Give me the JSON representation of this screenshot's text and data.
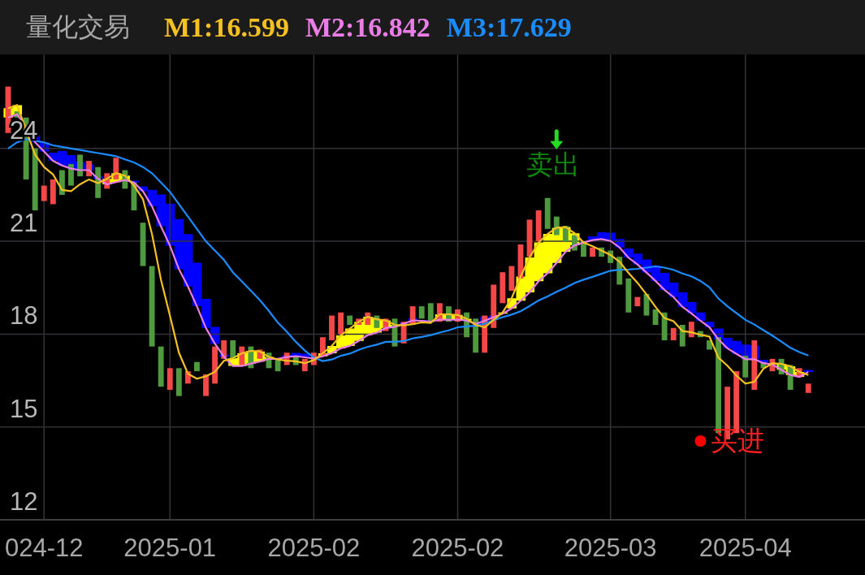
{
  "header": {
    "title": "量化交易",
    "readouts": [
      ":16.599",
      ":16.842",
      ":17.629"
    ]
  },
  "chart_data": {
    "type": "candlestick",
    "ylim": [
      12,
      27.04
    ],
    "grid": true,
    "categories": [
      null,
      null,
      null,
      null,
      "024-12",
      null,
      null,
      null,
      null,
      null,
      null,
      null,
      null,
      null,
      null,
      null,
      null,
      null,
      "2025-01",
      null,
      null,
      null,
      null,
      null,
      null,
      null,
      null,
      null,
      null,
      null,
      null,
      null,
      null,
      null,
      "2025-02",
      null,
      null,
      null,
      null,
      null,
      null,
      null,
      null,
      null,
      null,
      null,
      null,
      null,
      null,
      null,
      "2025-02",
      null,
      null,
      null,
      null,
      null,
      null,
      null,
      null,
      null,
      null,
      null,
      null,
      null,
      null,
      null,
      null,
      "2025-03",
      null,
      null,
      null,
      null,
      null,
      null,
      null,
      null,
      null,
      null,
      null,
      null,
      null,
      null,
      "2025-04",
      null,
      null,
      null,
      null,
      null,
      null,
      null
    ],
    "yticks": [
      12,
      15,
      18,
      21,
      24
    ],
    "ohlc": [
      [
        24.5,
        26,
        24.5,
        26
      ],
      [
        25.2,
        25.2,
        25,
        25
      ],
      [
        25,
        25,
        23,
        23
      ],
      [
        24,
        24,
        22,
        22
      ],
      [
        22.3,
        22.8,
        22.3,
        22.8
      ],
      [
        22.2,
        23,
        22.2,
        23
      ],
      [
        23.3,
        23.3,
        22.5,
        22.5
      ],
      [
        23.5,
        23.5,
        22.8,
        22.8
      ],
      [
        23.8,
        23.8,
        23.1,
        23.1
      ],
      [
        23.1,
        23.6,
        23.1,
        23.6
      ],
      [
        23.4,
        23.4,
        22.4,
        22.4
      ],
      [
        22.7,
        23.2,
        22.7,
        23.2
      ],
      [
        23,
        23.7,
        23,
        23.7
      ],
      [
        23.3,
        23.3,
        22.7,
        22.7
      ],
      [
        22.9,
        22.9,
        22,
        22
      ],
      [
        21.6,
        21.6,
        20.2,
        20.2
      ],
      [
        20.2,
        20.2,
        17.6,
        17.6
      ],
      [
        17.6,
        17.6,
        16.3,
        16.3
      ],
      [
        16.2,
        16.9,
        16.2,
        16.9
      ],
      [
        16.9,
        16.9,
        16,
        16
      ],
      [
        16.4,
        16.8,
        16.4,
        16.8
      ],
      [
        17.1,
        17.1,
        16.8,
        16.8
      ],
      [
        16,
        16.7,
        16,
        16.7
      ],
      [
        16.4,
        17.6,
        16.4,
        17.6
      ],
      [
        17.2,
        17.8,
        17.2,
        17.8
      ],
      [
        17.8,
        17.8,
        17.2,
        17.2
      ],
      [
        17,
        17.6,
        17,
        17.6
      ],
      [
        17.6,
        17.6,
        16.9,
        16.9
      ],
      [
        17.2,
        17.5,
        17.2,
        17.5
      ],
      [
        17.4,
        17.4,
        16.9,
        16.9
      ],
      [
        17.2,
        17.2,
        16.8,
        16.8
      ],
      [
        17,
        17.4,
        17,
        17.4
      ],
      [
        17.3,
        17.3,
        17,
        17
      ],
      [
        16.8,
        17.2,
        16.8,
        17.2
      ],
      [
        17,
        17.4,
        17,
        17.4
      ],
      [
        17.3,
        17.9,
        17.3,
        17.9
      ],
      [
        17.8,
        18.6,
        17.8,
        18.6
      ],
      [
        18,
        18.7,
        18,
        18.7
      ],
      [
        18.6,
        18.6,
        18.3,
        18.3
      ],
      [
        18.3,
        18.5,
        18.3,
        18.5
      ],
      [
        18.3,
        18.7,
        18.3,
        18.7
      ],
      [
        18.6,
        18.6,
        18.2,
        18.2
      ],
      [
        18.1,
        18.5,
        18.1,
        18.5
      ],
      [
        18.5,
        18.5,
        17.6,
        17.6
      ],
      [
        17.7,
        18.4,
        17.7,
        18.4
      ],
      [
        18.3,
        18.9,
        18.3,
        18.9
      ],
      [
        18.9,
        18.9,
        18.5,
        18.5
      ],
      [
        19,
        19,
        18.4,
        18.4
      ],
      [
        18.4,
        19,
        18.4,
        19
      ],
      [
        18.9,
        18.9,
        18.4,
        18.4
      ],
      [
        18.4,
        18.8,
        18.4,
        18.8
      ],
      [
        18.7,
        18.7,
        17.9,
        17.9
      ],
      [
        18.5,
        18.5,
        17.4,
        17.4
      ],
      [
        17.4,
        18.6,
        17.4,
        18.6
      ],
      [
        18.2,
        19.6,
        18.2,
        19.6
      ],
      [
        19,
        20,
        19,
        20
      ],
      [
        19.4,
        20.2,
        19.4,
        20.2
      ],
      [
        19.8,
        20.9,
        19.8,
        20.9
      ],
      [
        20.5,
        21.7,
        20.5,
        21.7
      ],
      [
        21,
        22,
        21,
        22
      ],
      [
        22.4,
        22.4,
        21.4,
        21.4
      ],
      [
        21.8,
        21.8,
        21.2,
        21.2
      ],
      [
        21.5,
        21.5,
        21,
        21
      ],
      [
        21.2,
        21.2,
        20.7,
        20.7
      ],
      [
        21,
        21,
        20.5,
        20.5
      ],
      [
        20.5,
        20.8,
        20.5,
        20.8
      ],
      [
        20.8,
        20.8,
        20.5,
        20.5
      ],
      [
        20.7,
        20.7,
        20.3,
        20.3
      ],
      [
        20.5,
        20.5,
        19.6,
        19.6
      ],
      [
        19.8,
        19.8,
        18.7,
        18.7
      ],
      [
        18.9,
        19.2,
        18.9,
        19.2
      ],
      [
        19.3,
        19.3,
        18.6,
        18.6
      ],
      [
        18.8,
        18.8,
        18.3,
        18.3
      ],
      [
        18.7,
        18.7,
        17.8,
        17.8
      ],
      [
        17.8,
        18.2,
        17.8,
        18.2
      ],
      [
        18.3,
        18.3,
        17.6,
        17.6
      ],
      [
        17.9,
        18.4,
        17.9,
        18.4
      ],
      [
        18.1,
        18.1,
        17.9,
        17.9
      ],
      [
        17.8,
        17.8,
        17.5,
        17.5
      ],
      [
        17.9,
        17.9,
        14.8,
        14.8
      ],
      [
        14.6,
        16.3,
        14.6,
        16.3
      ],
      [
        14.8,
        16.8,
        14.8,
        16.8
      ],
      [
        17.3,
        17.3,
        16.6,
        16.6
      ],
      [
        16.2,
        17.8,
        16.2,
        17.8
      ],
      [
        17.1,
        17.1,
        16.9,
        16.9
      ],
      [
        16.8,
        17.2,
        16.8,
        17.2
      ],
      [
        17.2,
        17.2,
        16.7,
        16.7
      ],
      [
        17,
        17,
        16.2,
        16.2
      ],
      [
        16.6,
        16.9,
        16.6,
        16.9
      ],
      [
        16.1,
        16.4,
        16.1,
        16.4
      ]
    ],
    "series": [
      {
        "name": "M1",
        "type": "line",
        "color": "#f5c021",
        "values": [
          25.3,
          25.4,
          24.6,
          23.8,
          23.4,
          23.16,
          22.66,
          22.62,
          22.84,
          23,
          22.88,
          23.02,
          23.2,
          23.12,
          22.8,
          22.36,
          21.24,
          19.76,
          18.6,
          17.4,
          16.72,
          16.56,
          16.64,
          16.78,
          17.14,
          17.22,
          17.38,
          17.46,
          17.44,
          17.26,
          17.18,
          17.14,
          17.12,
          17.06,
          17.16,
          17.38,
          17.62,
          17.96,
          18.18,
          18.4,
          18.56,
          18.48,
          18.44,
          18.3,
          18.28,
          18.32,
          18.38,
          18.36,
          18.64,
          18.64,
          18.62,
          18.5,
          18.3,
          18.22,
          18.46,
          18.7,
          19.16,
          19.86,
          20.48,
          20.96,
          21.24,
          21.44,
          21.46,
          21.26,
          20.96,
          20.84,
          20.7,
          20.56,
          20.34,
          19.98,
          19.66,
          19.28,
          18.88,
          18.52,
          18.42,
          18.1,
          18.06,
          17.98,
          17.92,
          17.24,
          16.98,
          16.66,
          16.4,
          16.46,
          16.88,
          17.06,
          17.04,
          16.96,
          16.78,
          16.68
        ]
      },
      {
        "name": "M2",
        "type": "line",
        "color": "#ea7ee6",
        "values": [
          25,
          25.1,
          24.7,
          24.2,
          23.9,
          23.6,
          23.45,
          23.35,
          23.3,
          23.3,
          23.02,
          22.84,
          22.91,
          22.98,
          22.9,
          22.62,
          22.13,
          21.48,
          20.86,
          20.1,
          19.54,
          18.9,
          18.2,
          17.69,
          17.27,
          16.97,
          16.97,
          17.05,
          17.11,
          17.2,
          17.2,
          17.26,
          17.29,
          17.25,
          17.21,
          17.28,
          17.38,
          17.54,
          17.62,
          17.78,
          17.97,
          18.05,
          18.2,
          18.24,
          18.34,
          18.44,
          18.43,
          18.4,
          18.47,
          18.46,
          18.47,
          18.44,
          18.33,
          18.43,
          18.55,
          18.66,
          18.83,
          19.08,
          19.35,
          19.71,
          19.97,
          20.3,
          20.66,
          20.87,
          20.96,
          21.04,
          21.07,
          21.01,
          20.8,
          20.47,
          20.25,
          19.99,
          19.72,
          19.43,
          19.2,
          18.88,
          18.67,
          18.43,
          18.22,
          17.83,
          17.54,
          17.36,
          17.19,
          17.19,
          17.06,
          17.02,
          16.85,
          16.68,
          16.62,
          16.78
        ]
      },
      {
        "name": "M3",
        "type": "line",
        "color": "#1a8cff",
        "values": [
          24,
          24.2,
          24.3,
          24.25,
          24.2,
          24.1,
          24.05,
          24,
          23.95,
          23.9,
          23.85,
          23.8,
          23.75,
          23.65,
          23.55,
          23.4,
          23.2,
          22.9,
          22.6,
          22.2,
          21.8,
          21.4,
          21,
          20.7,
          20.4,
          20,
          19.7,
          19.4,
          19.1,
          18.75,
          18.37,
          18.08,
          17.75,
          17.47,
          17.24,
          17.13,
          17.18,
          17.3,
          17.37,
          17.49,
          17.59,
          17.66,
          17.75,
          17.75,
          17.78,
          17.86,
          17.91,
          17.97,
          18.05,
          18.12,
          18.22,
          18.25,
          18.27,
          18.34,
          18.45,
          18.55,
          18.63,
          18.74,
          18.91,
          19.09,
          19.22,
          19.37,
          19.5,
          19.65,
          19.76,
          19.85,
          19.95,
          20.05,
          20.08,
          20.09,
          20.11,
          20.15,
          20.19,
          20.15,
          20.08,
          19.96,
          19.87,
          19.72,
          19.51,
          19.15,
          18.9,
          18.68,
          18.46,
          18.31,
          18.13,
          17.95,
          17.76,
          17.56,
          17.42,
          17.31
        ]
      }
    ],
    "annotations": [
      "卖出",
      "买进"
    ]
  }
}
